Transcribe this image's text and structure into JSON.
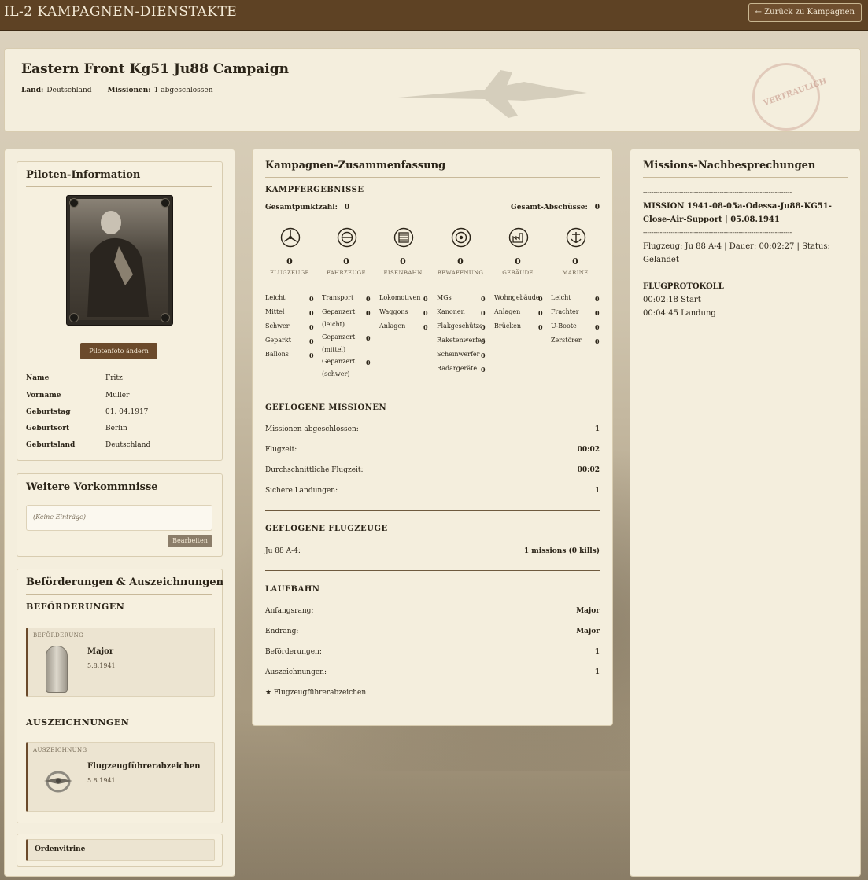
{
  "app": {
    "title": "IL-2 KAMPAGNEN-DIENSTAKTE",
    "back_label": "← Zurück zu Kampagnen"
  },
  "campaign": {
    "title": "Eastern Front Kg51 Ju88 Campaign",
    "country_label": "Land:",
    "country_value": "Deutschland",
    "missions_label": "Missionen:",
    "missions_value": "1 abgeschlossen",
    "stamp_text": "VERTRAULICH"
  },
  "pilot": {
    "title": "Piloten-Information",
    "change_photo_label": "Pilotenfoto ändern",
    "fields": [
      {
        "label": "Name",
        "value": "Fritz"
      },
      {
        "label": "Vorname",
        "value": "Müller"
      },
      {
        "label": "Geburtstag",
        "value": "01. 04.1917"
      },
      {
        "label": "Geburtsort",
        "value": "Berlin"
      },
      {
        "label": "Geburtsland",
        "value": "Deutschland"
      }
    ]
  },
  "events": {
    "title": "Weitere Vorkommnisse",
    "placeholder": "(Keine Einträge)",
    "edit_label": "Bearbeiten"
  },
  "awards": {
    "title": "Beförderungen & Auszeichnungen",
    "promotions_heading": "BEFÖRDERUNGEN",
    "promotion": {
      "kind": "BEFÖRDERUNG",
      "name": "Major",
      "date": "5.8.1941"
    },
    "decorations_heading": "AUSZEICHNUNGEN",
    "decoration": {
      "kind": "AUSZEICHNUNG",
      "name": "Flugzeugführerabzeichen",
      "date": "5.8.1941"
    },
    "vitrine_label": "Ordenvitrine"
  },
  "summary": {
    "title": "Kampagnen-Zusammenfassung",
    "combat_heading": "KAMPFERGEBNISSE",
    "total_points_label": "Gesamtpunktzahl:",
    "total_points_value": "0",
    "total_kills_label": "Gesamt-Abschüsse:",
    "total_kills_value": "0",
    "categories": [
      {
        "icon": "propeller-icon",
        "value": "0",
        "caption": "FLUGZEUGE",
        "items": [
          {
            "label": "Leicht",
            "value": "0"
          },
          {
            "label": "Mittel",
            "value": "0"
          },
          {
            "label": "Schwer",
            "value": "0"
          },
          {
            "label": "Geparkt",
            "value": "0"
          },
          {
            "label": "Ballons",
            "value": "0"
          }
        ]
      },
      {
        "icon": "vehicle-icon",
        "value": "0",
        "caption": "FAHRZEUGE",
        "items": [
          {
            "label": "Transport",
            "value": "0"
          },
          {
            "label": "Gepanzert (leicht)",
            "value": "0"
          },
          {
            "label": "Gepanzert (mittel)",
            "value": "0"
          },
          {
            "label": "Gepanzert (schwer)",
            "value": "0"
          }
        ]
      },
      {
        "icon": "railway-icon",
        "value": "0",
        "caption": "EISENBAHN",
        "items": [
          {
            "label": "Lokomotiven",
            "value": "0"
          },
          {
            "label": "Waggons",
            "value": "0"
          },
          {
            "label": "Anlagen",
            "value": "0"
          }
        ]
      },
      {
        "icon": "target-icon",
        "value": "0",
        "caption": "BEWAFFNUNG",
        "items": [
          {
            "label": "MGs",
            "value": "0"
          },
          {
            "label": "Kanonen",
            "value": "0"
          },
          {
            "label": "Flakgeschütze",
            "value": "0"
          },
          {
            "label": "Raketenwerfer",
            "value": "0"
          },
          {
            "label": "Scheinwerfer",
            "value": "0"
          },
          {
            "label": "Radargeräte",
            "value": "0"
          }
        ]
      },
      {
        "icon": "factory-icon",
        "value": "0",
        "caption": "GEBÄUDE",
        "items": [
          {
            "label": "Wohngebäude",
            "value": "0"
          },
          {
            "label": "Anlagen",
            "value": "0"
          },
          {
            "label": "Brücken",
            "value": "0"
          }
        ]
      },
      {
        "icon": "anchor-icon",
        "value": "0",
        "caption": "MARINE",
        "items": [
          {
            "label": "Leicht",
            "value": "0"
          },
          {
            "label": "Frachter",
            "value": "0"
          },
          {
            "label": "U-Boote",
            "value": "0"
          },
          {
            "label": "Zerstörer",
            "value": "0"
          }
        ]
      }
    ],
    "missions_heading": "GEFLOGENE MISSIONEN",
    "missions_rows": [
      {
        "label": "Missionen abgeschlossen:",
        "value": "1"
      },
      {
        "label": "Flugzeit:",
        "value": "00:02"
      },
      {
        "label": "Durchschnittliche Flugzeit:",
        "value": "00:02"
      },
      {
        "label": "Sichere Landungen:",
        "value": "1"
      }
    ],
    "aircraft_heading": "GEFLOGENE FLUGZEUGE",
    "aircraft_rows": [
      {
        "label": "Ju 88 A-4:",
        "value": "1 missions (0 kills)"
      }
    ],
    "career_heading": "LAUFBAHN",
    "career_rows": [
      {
        "label": "Anfangsrang:",
        "value": "Major"
      },
      {
        "label": "Endrang:",
        "value": "Major"
      },
      {
        "label": "Beförderungen:",
        "value": "1"
      },
      {
        "label": "Auszeichnungen:",
        "value": "1"
      }
    ],
    "career_award": "★  Flugzeugführerabzeichen"
  },
  "debriefings": {
    "title": "Missions-Nachbesprechungen",
    "separator": "----------------------------------------------------------------------",
    "mission_title": "MISSION 1941-08-05a-Odessa-Ju88-KG51-Close-Air-Support",
    "mission_date": " | 05.08.1941",
    "flight_info": "Flugzeug: Ju 88 A-4 | Dauer: 00:02:27 | Status: Gelandet",
    "log_heading": "FLUGPROTOKOLL",
    "log": [
      "00:02:18 Start",
      "00:04:45 Landung"
    ]
  }
}
